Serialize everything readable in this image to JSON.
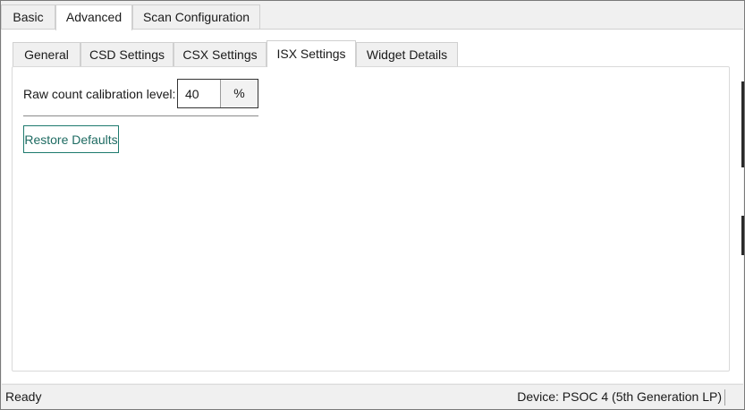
{
  "top_tabs": [
    {
      "label": "Basic",
      "active": false
    },
    {
      "label": "Advanced",
      "active": true
    },
    {
      "label": "Scan Configuration",
      "active": false
    }
  ],
  "inner_tabs": [
    {
      "label": "General",
      "active": false
    },
    {
      "label": "CSD Settings",
      "active": false
    },
    {
      "label": "CSX Settings",
      "active": false
    },
    {
      "label": "ISX Settings",
      "active": true
    },
    {
      "label": "Widget Details",
      "active": false
    }
  ],
  "isx_settings": {
    "raw_count_label": "Raw count calibration level:",
    "raw_count_value": "40",
    "raw_count_unit": "%",
    "restore_label": "Restore Defaults"
  },
  "status": {
    "left": "Ready",
    "right": "Device: PSOC 4 (5th Generation LP)"
  },
  "colors": {
    "accent_border": "#1e7a6e",
    "pane_background": "#ffffff",
    "chrome_background": "#f0f0f0"
  }
}
